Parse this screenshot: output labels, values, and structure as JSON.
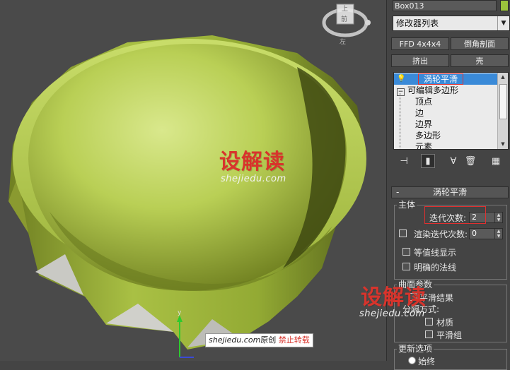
{
  "viewport": {
    "viewcube": {
      "top_label": "上",
      "front_label": "前",
      "left_label": "左"
    },
    "axis": {
      "y_label": "y"
    },
    "colors": {
      "object": "#b7cf52",
      "background": "#4a4a4a",
      "selection_red": "#e03030"
    },
    "watermark": {
      "main": "设解读",
      "url": "shejiedu.com",
      "credit_url": "shejiedu.com",
      "credit_text": "原创",
      "credit_warning": "禁止转载"
    }
  },
  "panel": {
    "object_name": "Box013",
    "object_color": "#9cc43c",
    "modifier_list": "修改器列表",
    "buttons": {
      "ffd": "FFD 4x4x4",
      "chamfer": "倒角剖面",
      "extrude": "挤出",
      "shell": "壳"
    },
    "stack": {
      "items": [
        {
          "label": "涡轮平滑",
          "selected": true
        },
        {
          "label": "可编辑多边形",
          "expanded": true
        },
        {
          "label": "顶点"
        },
        {
          "label": "边"
        },
        {
          "label": "边界"
        },
        {
          "label": "多边形"
        },
        {
          "label": "元素"
        }
      ]
    },
    "toolbar_icons": [
      "pin-stack-icon",
      "show-end-result-icon",
      "make-unique-icon",
      "remove-modifier-icon",
      "configure-sets-icon"
    ],
    "rollout": {
      "title": "涡轮平滑",
      "collapse": "-",
      "main_group": "主体",
      "iterations_label": "迭代次数:",
      "iterations_value": "2",
      "render_iters_label": "渲染迭代次数:",
      "render_iters_value": "0",
      "isoline_label": "等值线显示",
      "explicit_normals_label": "明确的法线",
      "surface_group": "曲面参数",
      "smooth_result_label": "平滑结果",
      "separate_by_label": "分隔方式:",
      "material_label": "材质",
      "smoothing_groups_label": "平滑组",
      "update_group": "更新选项",
      "always_label": "始终"
    }
  }
}
